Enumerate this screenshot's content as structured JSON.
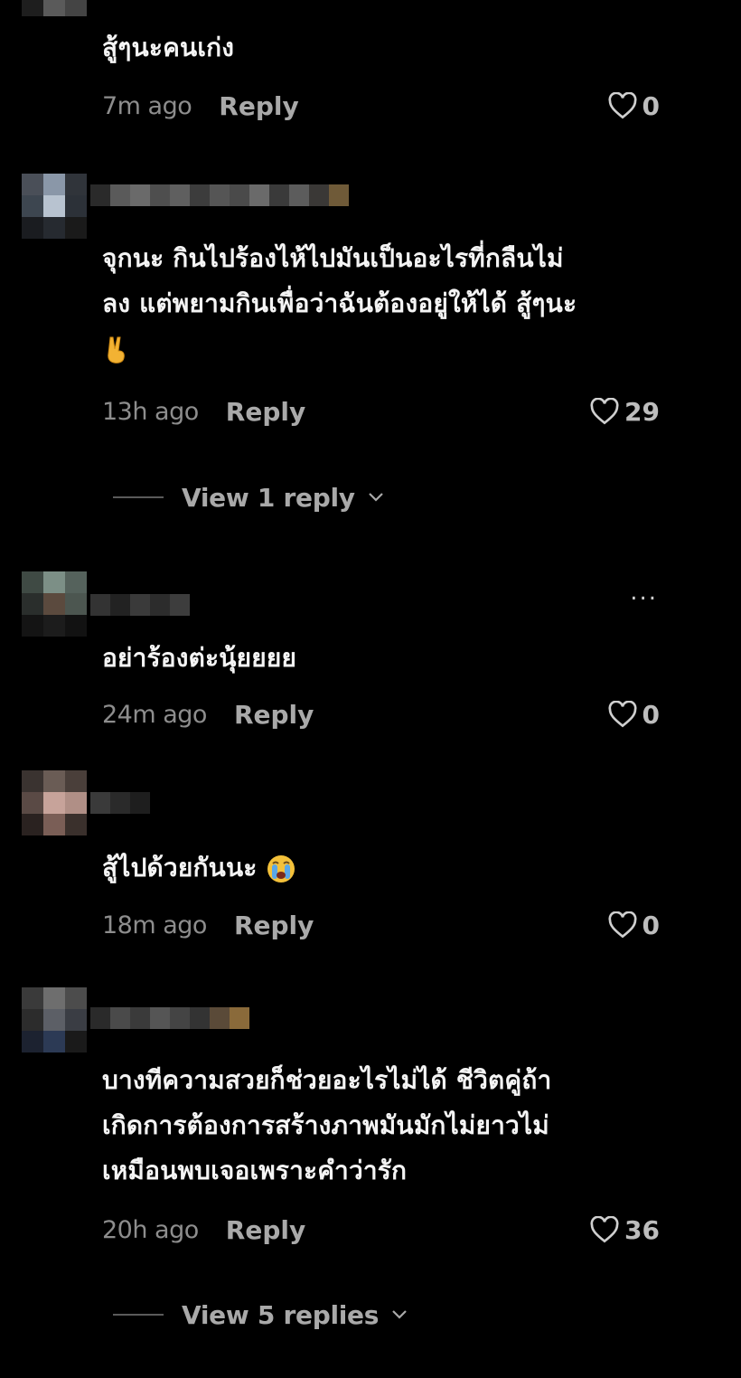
{
  "comments": [
    {
      "text_lines": [
        "สู้ๆนะคนเก่ง"
      ],
      "time": "7m ago",
      "reply": "Reply",
      "likes": "0"
    },
    {
      "text_lines": [
        "จุกนะ กินไปร้องไห้ไปมันเป็นอะไรที่กลืนไม่",
        "ลง แต่พยามกินเพื่อว่าฉันต้องอยู่ให้ได้ สู้ๆนะ"
      ],
      "time": "13h ago",
      "reply": "Reply",
      "likes": "29",
      "view_replies": "View 1 reply"
    },
    {
      "text_lines": [
        "อย่าร้องต่ะนุ้ยยยย"
      ],
      "time": "24m ago",
      "reply": "Reply",
      "likes": "0",
      "more": "..."
    },
    {
      "text_lines": [
        "สู้ไปด้วยกันนะ"
      ],
      "time": "18m ago",
      "reply": "Reply",
      "likes": "0"
    },
    {
      "text_lines": [
        "บางทีความสวยก็ช่วยอะไรไม่ได้ ชีวิตคู่ถ้า",
        "เกิดการต้องการสร้างภาพมันมักไม่ยาวไม่",
        "เหมือนพบเจอเพราะคำว่ารัก"
      ],
      "time": "20h ago",
      "reply": "Reply",
      "likes": "36",
      "view_replies": "View 5 replies"
    }
  ],
  "icons": {
    "like": "heart-outline-icon",
    "expand": "chevron-down-icon",
    "more": "more-options-icon"
  },
  "colors": {
    "background": "#000000",
    "text": "#f4f4f4",
    "muted": "#8d8d8d",
    "action": "#a9a9a9"
  }
}
